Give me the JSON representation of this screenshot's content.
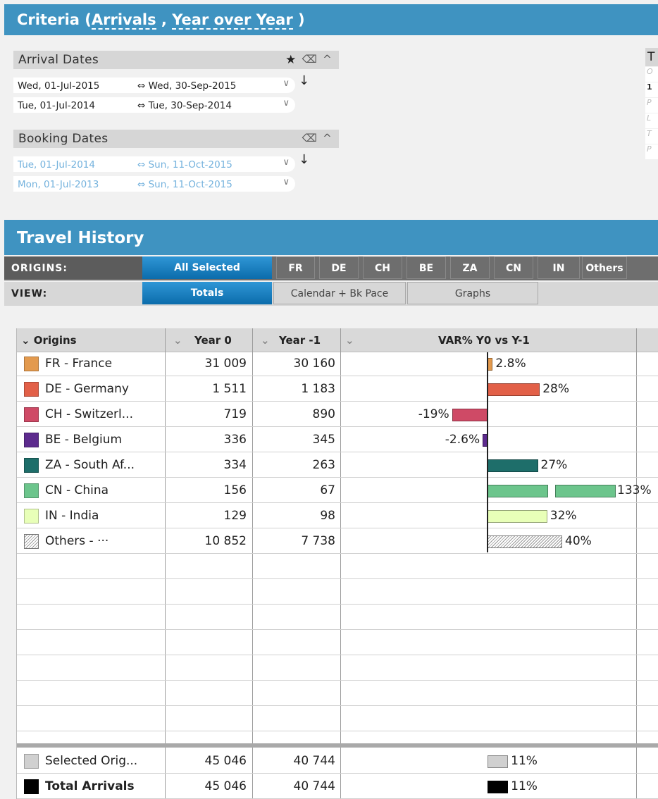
{
  "criteria": {
    "prefix": "Criteria (",
    "measure": "Arrivals",
    "separator": " , ",
    "mode": "Year over Year",
    "suffix": " )"
  },
  "arrival_dates": {
    "title": "Arrival Dates",
    "rows": [
      {
        "from": "Wed, 01-Jul-2015",
        "to": "⇔ Wed, 30-Sep-2015"
      },
      {
        "from": "Tue,  01-Jul-2014",
        "to": "⇔ Tue,  30-Sep-2014"
      }
    ]
  },
  "booking_dates": {
    "title": "Booking Dates",
    "rows": [
      {
        "from": "Tue,  01-Jul-2014",
        "to": "⇔ Sun,  11-Oct-2015"
      },
      {
        "from": "Mon, 01-Jul-2013",
        "to": "⇔ Sun,  11-Oct-2015"
      }
    ]
  },
  "right_panel": {
    "title": "T",
    "items": [
      "O",
      "1",
      "P",
      "L",
      "T",
      "P"
    ]
  },
  "travel_history": {
    "title": "Travel History"
  },
  "origins_bar": {
    "label": "ORIGINS:",
    "all_selected": "All Selected",
    "buttons": [
      "FR",
      "DE",
      "CH",
      "BE",
      "ZA",
      "CN",
      "IN",
      "Others"
    ]
  },
  "view_bar": {
    "label": "VIEW:",
    "buttons": [
      "Totals",
      "Calendar + Bk Pace",
      "Graphs"
    ]
  },
  "table": {
    "headers": {
      "origins": "Origins",
      "year0": "Year 0",
      "year1": "Year -1",
      "var": "VAR% Y0 vs Y-1"
    },
    "rows": [
      {
        "name": "FR - France",
        "color": "#e39a4e",
        "y0": "31 009",
        "y1": "30 160",
        "var": 2.8,
        "var_label": "2.8%"
      },
      {
        "name": "DE - Germany",
        "color": "#e26048",
        "y0": "1 511",
        "y1": "1 183",
        "var": 28,
        "var_label": "28%"
      },
      {
        "name": "CH - Switzerl...",
        "color": "#cf4a66",
        "y0": "719",
        "y1": "890",
        "var": -19,
        "var_label": "-19%"
      },
      {
        "name": "BE - Belgium",
        "color": "#5d2b8e",
        "y0": "336",
        "y1": "345",
        "var": -2.6,
        "var_label": "-2.6%"
      },
      {
        "name": "ZA - South Af...",
        "color": "#1e6e6a",
        "y0": "334",
        "y1": "263",
        "var": 27,
        "var_label": "27%"
      },
      {
        "name": "CN - China",
        "color": "#6cc58c",
        "y0": "156",
        "y1": "67",
        "var": 133,
        "var_label": "133%"
      },
      {
        "name": "IN - India",
        "color": "#e8ffb8",
        "y0": "129",
        "y1": "98",
        "var": 32,
        "var_label": "32%"
      },
      {
        "name": "Others - ···",
        "color": "hatch",
        "y0": "10 852",
        "y1": "7 738",
        "var": 40,
        "var_label": "40%"
      }
    ],
    "totals": [
      {
        "name": "Selected Orig...",
        "color": "#d0d0d0",
        "y0": "45 046",
        "y1": "40 744",
        "var": 11,
        "var_label": "11%",
        "bold": false
      },
      {
        "name": "Total Arrivals",
        "color": "#000000",
        "y0": "45 046",
        "y1": "40 744",
        "var": 11,
        "var_label": "11%",
        "bold": true
      }
    ]
  }
}
